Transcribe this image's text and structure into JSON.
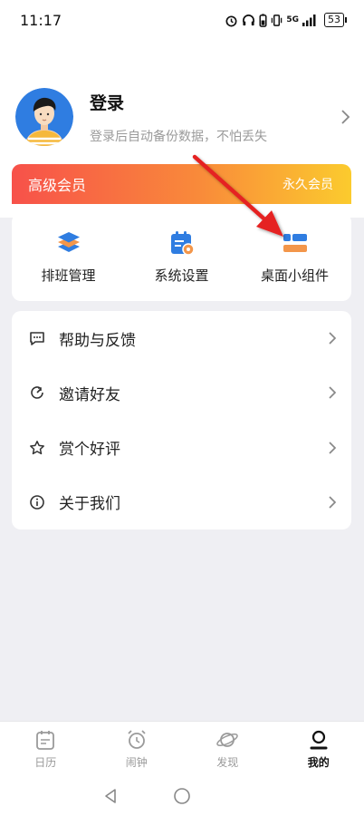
{
  "status_bar": {
    "time": "11:17",
    "network": "5G",
    "battery": "53",
    "icons": [
      "alarm-icon",
      "headphones-icon",
      "battery-saver-icon",
      "vibrate-icon",
      "signal-icon"
    ]
  },
  "profile": {
    "title": "登录",
    "subtitle": "登录后自动备份数据，不怕丢失",
    "avatar_icon": "avatar-icon"
  },
  "vip": {
    "title": "高级会员",
    "status": "永久会员",
    "gradient": [
      "#f7514a",
      "#f98a3a",
      "#fbcb2e"
    ]
  },
  "quick_actions": [
    {
      "label": "排班管理",
      "icon": "layers-icon"
    },
    {
      "label": "系统设置",
      "icon": "calendar-settings-icon"
    },
    {
      "label": "桌面小组件",
      "icon": "widget-icon"
    }
  ],
  "menu": [
    {
      "label": "帮助与反馈",
      "icon": "chat-bubble-icon"
    },
    {
      "label": "邀请好友",
      "icon": "share-icon"
    },
    {
      "label": "赏个好评",
      "icon": "star-icon"
    },
    {
      "label": "关于我们",
      "icon": "info-icon"
    }
  ],
  "tabs": [
    {
      "label": "日历",
      "icon": "calendar-icon",
      "active": false
    },
    {
      "label": "闹钟",
      "icon": "alarm-clock-icon",
      "active": false
    },
    {
      "label": "发现",
      "icon": "planet-icon",
      "active": false
    },
    {
      "label": "我的",
      "icon": "person-icon",
      "active": true
    }
  ],
  "colors": {
    "accent_blue": "#2f7de1",
    "accent_orange": "#f3964a",
    "annotation_arrow": "#e52222",
    "background": "#efeff3"
  }
}
